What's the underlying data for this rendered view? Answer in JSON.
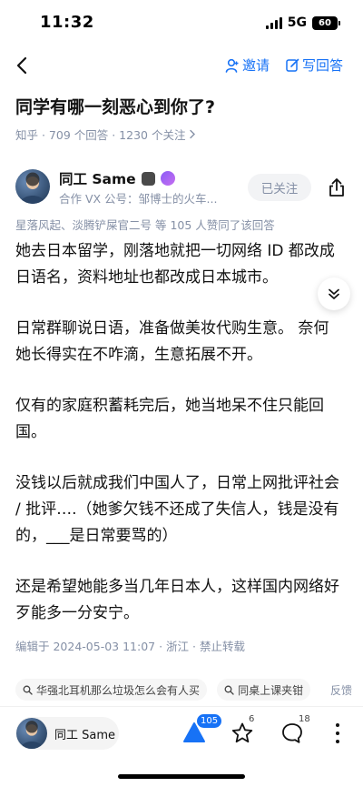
{
  "status_bar": {
    "time": "11:32",
    "network": "5G",
    "battery": "60"
  },
  "nav": {
    "invite_label": "邀请",
    "write_answer_label": "写回答",
    "accent_color": "#1772f6"
  },
  "question": {
    "title": "同学有哪一刻恶心到你了?",
    "meta": "知乎 · 709 个回答 · 1230 个关注"
  },
  "author": {
    "name": "同工 Same",
    "bio": "合作 VX 公号：邹博士的火车...",
    "follow_label": "已关注"
  },
  "likes_line": "星落风起、淡腾铲屎官二号 等 105 人赞同了该回答",
  "content": {
    "p1": "她去日本留学，刚落地就把一切网络 ID 都改成日语名，资料地址也都改成日本城市。",
    "p2": "日常群聊说日语，准备做美妆代购生意。 奈何她长得实在不咋滴，生意拓展不开。",
    "p3": "仅有的家庭积蓄耗完后，她当地呆不住只能回国。",
    "p4": "没钱以后就成我们中国人了，日常上网批评社会 / 批评….（她爹欠钱不还成了失信人，钱是没有的，___是日常要骂的）",
    "p5": "还是希望她能多当几年日本人，这样国内网络好歹能多一分安宁。"
  },
  "edit_meta": "编辑于 2024-05-03 11:07 · 浙江 · 禁止转载",
  "related": [
    {
      "label": "华强北耳机那么垃圾怎么会有人买"
    },
    {
      "label": "同桌上课夹钳"
    }
  ],
  "feedback_label": "反馈",
  "bottom_bar": {
    "user_name": "同工 Same",
    "upvote_count": "105",
    "favorite_count": "6",
    "comment_count": "18"
  }
}
